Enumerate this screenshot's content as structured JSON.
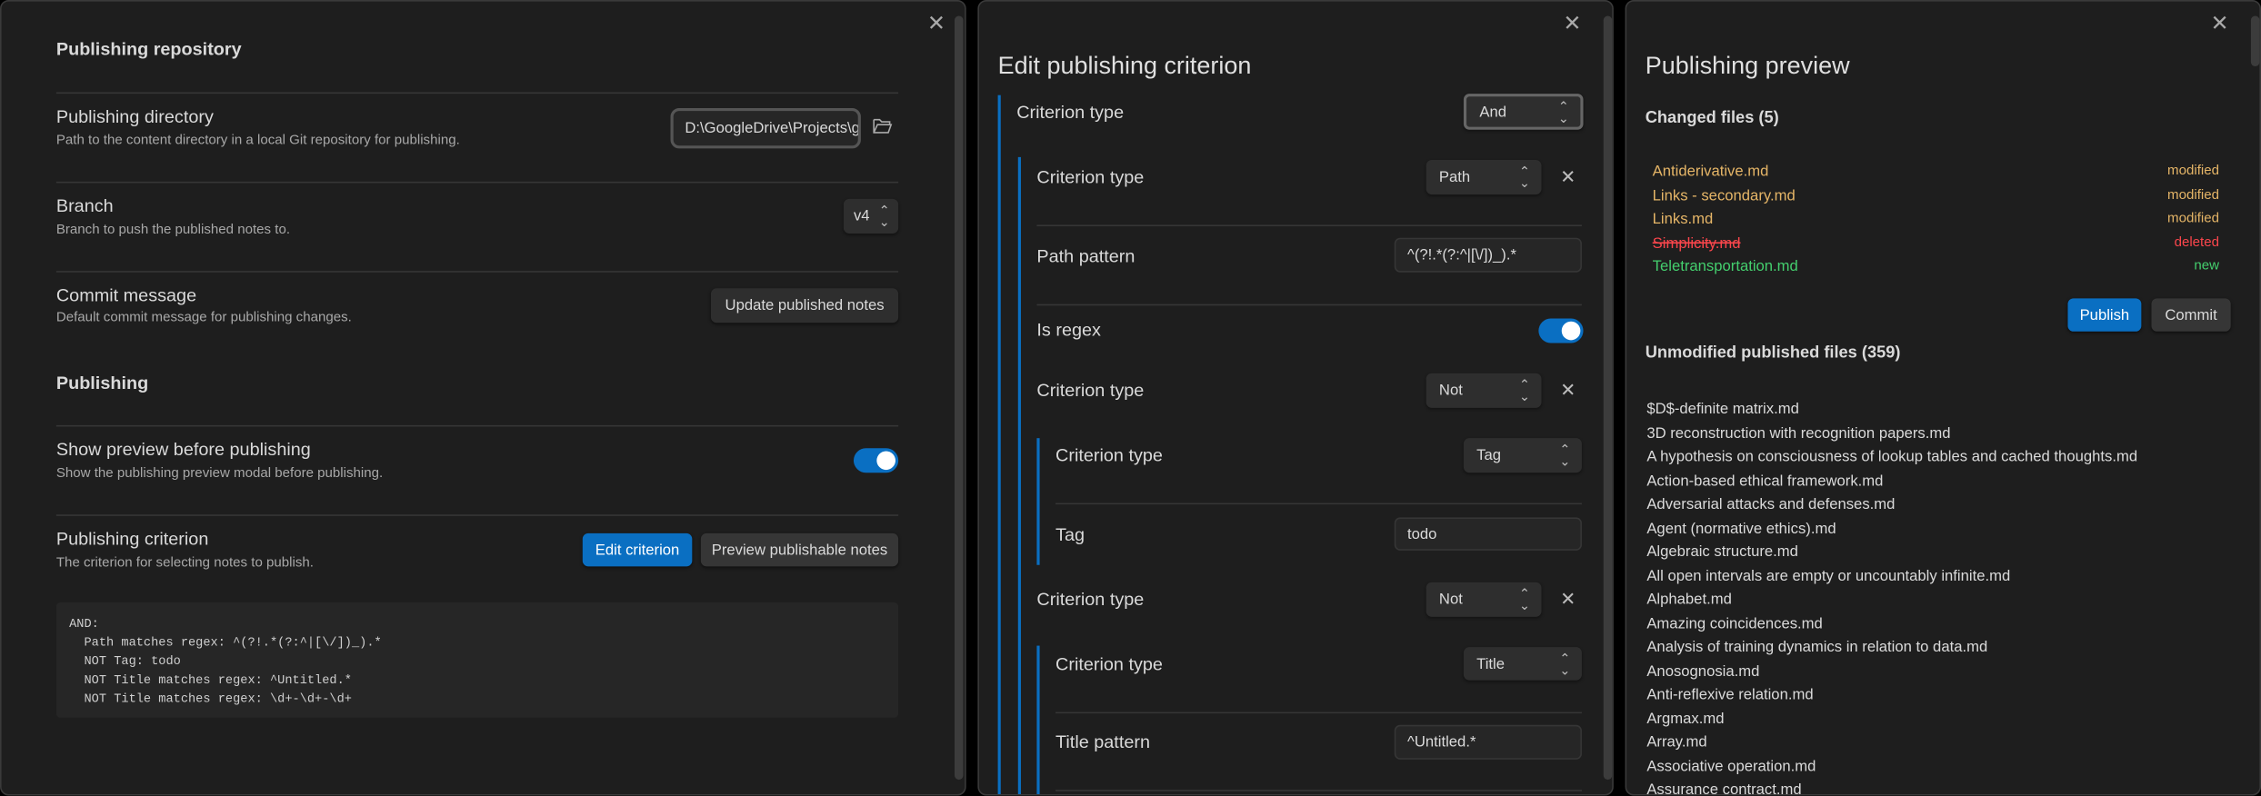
{
  "settings": {
    "close_label": "✕",
    "section_repository": "Publishing repository",
    "directory": {
      "title": "Publishing directory",
      "desc": "Path to the content directory in a local Git repository for publishing.",
      "value": "D:\\GoogleDrive\\Projects\\g"
    },
    "branch": {
      "title": "Branch",
      "desc": "Branch to push the published notes to.",
      "value": "v4"
    },
    "commit": {
      "title": "Commit message",
      "desc": "Default commit message for publishing changes.",
      "button": "Update published notes"
    },
    "section_publishing": "Publishing",
    "preview": {
      "title": "Show preview before publishing",
      "desc": "Show the publishing preview modal before publishing.",
      "enabled": true
    },
    "criterion": {
      "title": "Publishing criterion",
      "desc": "The criterion for selecting notes to publish.",
      "edit_button": "Edit criterion",
      "preview_button": "Preview publishable notes"
    },
    "criterion_summary": [
      "AND:",
      "  Path matches regex: ^(?!.*(?:^|[\\/])_).*",
      "  NOT Tag: todo",
      "  NOT Title matches regex: ^Untitled.*",
      "  NOT Title matches regex: \\d+-\\d+-\\d+"
    ]
  },
  "editor": {
    "close_label": "✕",
    "title": "Edit publishing criterion",
    "criterion_type_label": "Criterion type",
    "remove_label": "✕",
    "root_type": "And",
    "c1_type": "Path",
    "path_pattern_label": "Path pattern",
    "path_pattern": "^(?!.*(?:^|[\\/])_).*",
    "is_regex_label": "Is regex",
    "is_regex": true,
    "c2_type": "Not",
    "c2_inner_type": "Tag",
    "tag_label": "Tag",
    "tag_value": "todo",
    "c3_type": "Not",
    "c3_inner_type": "Title",
    "title_pattern_label": "Title pattern",
    "title_pattern": "^Untitled.*"
  },
  "preview": {
    "close_label": "✕",
    "title": "Publishing preview",
    "changed_heading": "Changed files (5)",
    "changed": [
      {
        "name": "Antiderivative.md",
        "status": "modified"
      },
      {
        "name": "Links - secondary.md",
        "status": "modified"
      },
      {
        "name": "Links.md",
        "status": "modified"
      },
      {
        "name": "Simplicity.md",
        "status": "deleted"
      },
      {
        "name": "Teletransportation.md",
        "status": "new"
      }
    ],
    "status_colors": {
      "modified": "#e5b567",
      "deleted": "#fb464c",
      "new": "#44cf6e"
    },
    "publish_button": "Publish",
    "commit_button": "Commit",
    "unmodified_heading": "Unmodified published files (359)",
    "unmodified": [
      "$D$-definite matrix.md",
      "3D reconstruction with recognition papers.md",
      "A hypothesis on consciousness of lookup tables and cached thoughts.md",
      "Action-based ethical framework.md",
      "Adversarial attacks and defenses.md",
      "Agent (normative ethics).md",
      "Algebraic structure.md",
      "All open intervals are empty or uncountably infinite.md",
      "Alphabet.md",
      "Amazing coincidences.md",
      "Analysis of training dynamics in relation to data.md",
      "Anosognosia.md",
      "Anti-reflexive relation.md",
      "Argmax.md",
      "Array.md",
      "Associative operation.md",
      "Assurance contract.md"
    ]
  }
}
